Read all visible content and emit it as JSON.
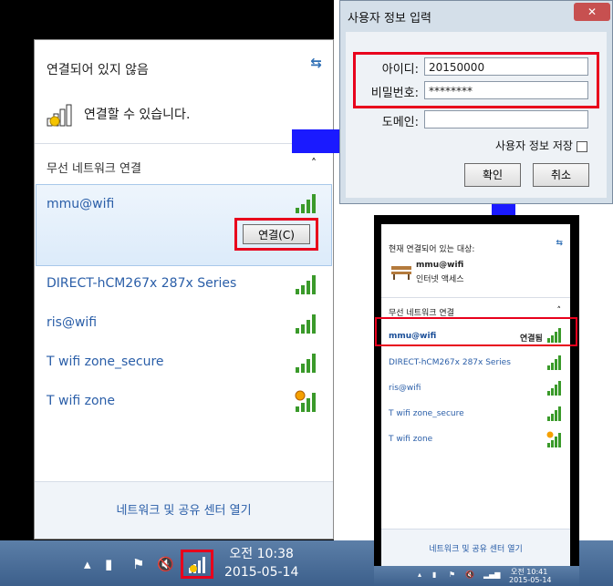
{
  "panel_left": {
    "status": "연결되어 있지 않음",
    "connectable": "연결할 수 있습니다.",
    "section": "무선 네트워크 연결",
    "selected_network": "mmu@wifi",
    "connect_button": "연결(C)",
    "networks": [
      "DIRECT-hCM267x 287x Series",
      "ris@wifi",
      "T wifi zone_secure",
      "T wifi zone"
    ],
    "footer_link": "네트워크 및 공유 센터 열기",
    "clock_time": "오전 10:38",
    "clock_date": "2015-05-14"
  },
  "dialog": {
    "title": "사용자 정보 입력",
    "id_label": "아이디:",
    "id_value": "20150000",
    "pw_label": "비밀번호:",
    "pw_value": "********",
    "domain_label": "도메인:",
    "domain_value": "",
    "save_label": "사용자 정보 저장",
    "ok_button": "확인",
    "cancel_button": "취소"
  },
  "panel_right": {
    "status": "현재 연결되어 있는 대상:",
    "current_network": "mmu@wifi",
    "access": "인터넷 액세스",
    "section": "무선 네트워크 연결",
    "connected_network": "mmu@wifi",
    "connected_status": "연결됨",
    "networks": [
      "DIRECT-hCM267x 287x Series",
      "ris@wifi",
      "T wifi zone_secure",
      "T wifi zone"
    ],
    "footer_link": "네트워크 및 공유 센터 열기",
    "clock_time": "오전 10:41",
    "clock_date": "2015-05-14"
  },
  "colors": {
    "highlight": "#e8001c",
    "arrow": "#1a1aff",
    "link": "#2a5ea8",
    "signal": "#3a9a2a"
  },
  "icons": [
    "refresh-icon",
    "signal-icon",
    "warning-icon",
    "flag-icon",
    "volume-mute-icon",
    "network-tray-icon",
    "bench-icon"
  ]
}
